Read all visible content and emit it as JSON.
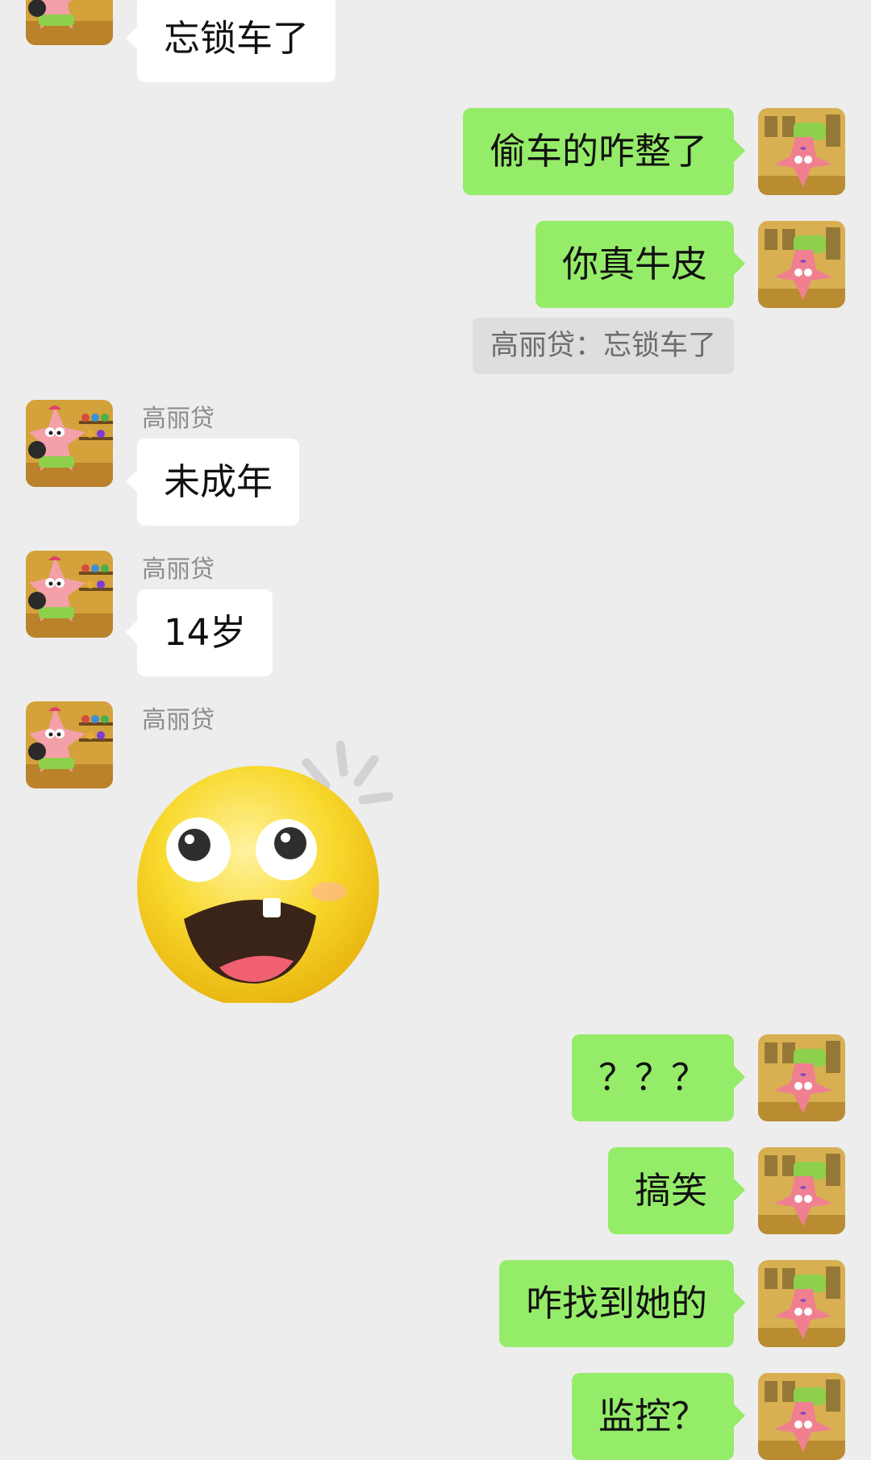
{
  "messages": {
    "m1": {
      "text": "忘锁车了"
    },
    "m2": {
      "text": "偷车的咋整了"
    },
    "m3": {
      "text": "你真牛皮"
    },
    "quote": {
      "text": "高丽贷：忘锁车了"
    },
    "m4": {
      "sender": "高丽贷",
      "text": "未成年"
    },
    "m5": {
      "sender": "高丽贷",
      "text": "14岁"
    },
    "m6": {
      "sender": "高丽贷",
      "sticker": "surprised-emoji-sticker"
    },
    "m7": {
      "text": "？？？"
    },
    "m8": {
      "text": "搞笑"
    },
    "m9": {
      "text": "咋找到她的"
    },
    "m10": {
      "text": "监控？"
    }
  },
  "icons": {
    "contact_avatar": "patrick-star-avatar",
    "own_avatar": "patrick-star-handstand-avatar"
  },
  "colors": {
    "background": "#ededed",
    "outgoing_bubble": "#95ec69",
    "incoming_bubble": "#ffffff",
    "quote_background": "#dedede"
  }
}
